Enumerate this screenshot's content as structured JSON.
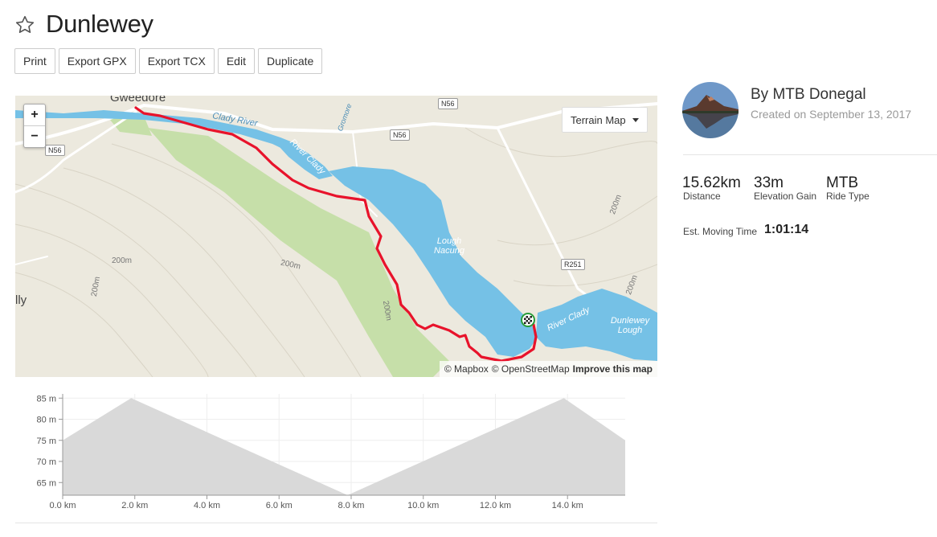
{
  "route": {
    "title": "Dunlewey"
  },
  "toolbar": {
    "print": "Print",
    "export_gpx": "Export GPX",
    "export_tcx": "Export TCX",
    "edit": "Edit",
    "duplicate": "Duplicate"
  },
  "map": {
    "zoom_in": "+",
    "zoom_out": "−",
    "layer_selector": "Terrain Map",
    "attribution_mapbox": "© Mapbox",
    "attribution_osm": "© OpenStreetMap",
    "improve_link": "Improve this map",
    "labels": {
      "town_gweedore": "Gweedore",
      "town_partial": "lly",
      "clady_river_1": "Clady River",
      "clady_river_2": "River Clady",
      "clady_river_3": "River Clady",
      "lough_nacung": "Lough Nacung",
      "dunlewey_lough": "Dunlewey Lough",
      "gromore": "Gromore",
      "contour_1": "200m",
      "contour_2": "200m",
      "contour_3": "200m",
      "contour_4": "200m",
      "contour_5": "200m",
      "contour_6": "200m"
    },
    "road_badges": {
      "n56_a": "N56",
      "n56_b": "N56",
      "n56_c": "N56",
      "r251": "R251"
    }
  },
  "owner": {
    "by": "By MTB Donegal",
    "created": "Created on September 13, 2017"
  },
  "stats": {
    "distance_value": "15.62km",
    "distance_label": "Distance",
    "elevation_value": "33m",
    "elevation_label": "Elevation Gain",
    "ride_type_value": "MTB",
    "ride_type_label": "Ride Type",
    "moving_time_label": "Est. Moving Time",
    "moving_time_value": "1:01:14"
  },
  "colors": {
    "route": "#e8132b",
    "water": "#75c1e6",
    "forest": "#c6dfa9",
    "land": "#ece9de",
    "elevation_fill": "#d9d9d9"
  },
  "chart_data": {
    "type": "area",
    "x": [
      0,
      1.9,
      7.9,
      13.9,
      15.6
    ],
    "y": [
      75,
      85,
      62,
      85,
      75
    ],
    "xlim": [
      0,
      15.6
    ],
    "ylim": [
      62,
      86
    ],
    "x_ticks": [
      "0.0 km",
      "2.0 km",
      "4.0 km",
      "6.0 km",
      "8.0 km",
      "10.0 km",
      "12.0 km",
      "14.0 km"
    ],
    "y_ticks": [
      "65 m",
      "70 m",
      "75 m",
      "80 m",
      "85 m"
    ],
    "x_tick_values": [
      0,
      2,
      4,
      6,
      8,
      10,
      12,
      14
    ],
    "y_tick_values": [
      65,
      70,
      75,
      80,
      85
    ],
    "grid": true
  }
}
